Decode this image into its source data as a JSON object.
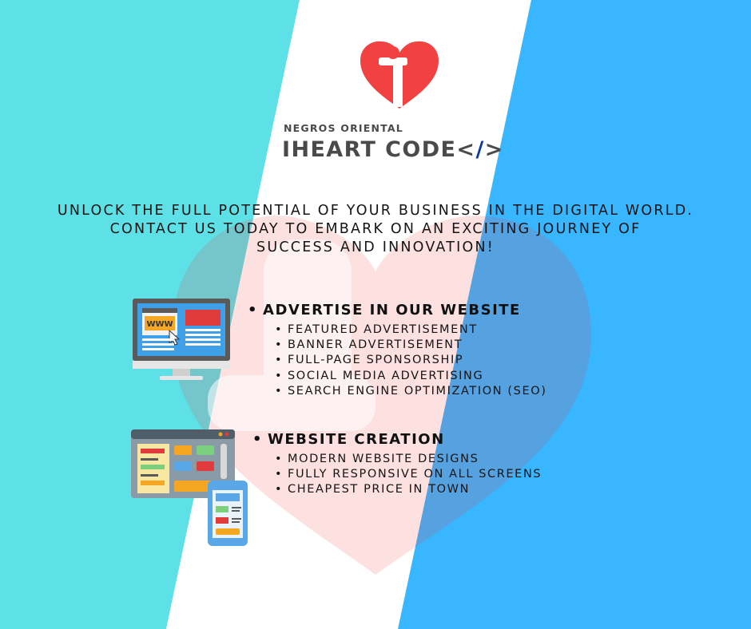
{
  "brand": {
    "top_line": "NEGROS ORIENTAL",
    "name": "IHEART CODE",
    "code_open": "<",
    "code_slash": "/",
    "code_close": ">"
  },
  "tagline": {
    "line1": "UNLOCK THE FULL POTENTIAL OF YOUR BUSINESS IN THE DIGITAL WORLD.",
    "line2": "CONTACT US TODAY TO EMBARK ON AN EXCITING JOURNEY OF",
    "line3": "SUCCESS AND INNOVATION!"
  },
  "services": [
    {
      "title": "ADVERTISE IN OUR WEBSITE",
      "items": [
        "FEATURED ADVERTISEMENT",
        "BANNER ADVERTISEMENT",
        "FULL-PAGE SPONSORSHIP",
        "SOCIAL MEDIA ADVERTISING",
        "SEARCH ENGINE OPTIMIZATION (SEO)"
      ]
    },
    {
      "title": "WEBSITE CREATION",
      "items": [
        "MODERN WEBSITE DESIGNS",
        "FULLY RESPONSIVE ON ALL SCREENS",
        "CHEAPEST PRICE IN TOWN"
      ]
    }
  ],
  "illustration": {
    "monitor_text": "WWW"
  },
  "colors": {
    "cyan": "#5ee1e6",
    "blue": "#38b6ff",
    "red": "#f24141",
    "dark_text": "#4a4a4a",
    "accent_slash": "#0b3a9a"
  },
  "icons": {
    "logo": "heart-i-logo-icon",
    "monitor": "monitor-web-icon",
    "devices": "website-devices-icon"
  }
}
